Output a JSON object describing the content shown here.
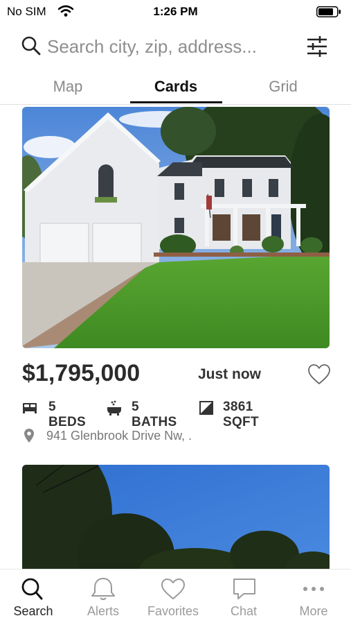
{
  "status_bar": {
    "carrier": "No SIM",
    "time": "1:26 PM"
  },
  "search": {
    "placeholder": "Search city, zip, address..."
  },
  "tabs": [
    {
      "label": "Map"
    },
    {
      "label": "Cards"
    },
    {
      "label": "Grid"
    }
  ],
  "active_tab": "Cards",
  "listing": {
    "price": "$1,795,000",
    "posted": "Just now",
    "beds": "5 BEDS",
    "baths": "5 BATHS",
    "sqft": "3861 SQFT",
    "address": "941 Glenbrook Drive Nw, ."
  },
  "bottom_nav": [
    {
      "label": "Search",
      "icon": "search-icon"
    },
    {
      "label": "Alerts",
      "icon": "bell-icon"
    },
    {
      "label": "Favorites",
      "icon": "heart-icon"
    },
    {
      "label": "Chat",
      "icon": "chat-icon"
    },
    {
      "label": "More",
      "icon": "more-icon"
    }
  ],
  "colors": {
    "accent": "#111111",
    "inactive": "#9a9a9a",
    "lawn": "#4c9a2a",
    "sky": "#3f7fd8"
  }
}
